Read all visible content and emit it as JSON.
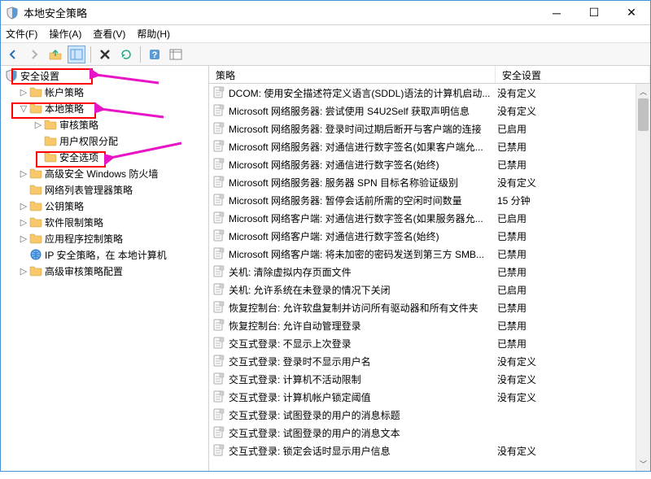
{
  "window": {
    "title": "本地安全策略"
  },
  "menu": {
    "file": "文件(F)",
    "action": "操作(A)",
    "view": "查看(V)",
    "help": "帮助(H)"
  },
  "tree": {
    "root": "安全设置",
    "items": [
      {
        "label": "帐户策略",
        "indent": 1,
        "exp": "▷",
        "type": "folder"
      },
      {
        "label": "本地策略",
        "indent": 1,
        "exp": "▽",
        "type": "folder"
      },
      {
        "label": "审核策略",
        "indent": 2,
        "exp": "▷",
        "type": "folder"
      },
      {
        "label": "用户权限分配",
        "indent": 2,
        "exp": "",
        "type": "folder"
      },
      {
        "label": "安全选项",
        "indent": 2,
        "exp": "",
        "type": "folder"
      },
      {
        "label": "高级安全 Windows 防火墙",
        "indent": 1,
        "exp": "▷",
        "type": "folder"
      },
      {
        "label": "网络列表管理器策略",
        "indent": 1,
        "exp": "",
        "type": "folder"
      },
      {
        "label": "公钥策略",
        "indent": 1,
        "exp": "▷",
        "type": "folder"
      },
      {
        "label": "软件限制策略",
        "indent": 1,
        "exp": "▷",
        "type": "folder"
      },
      {
        "label": "应用程序控制策略",
        "indent": 1,
        "exp": "▷",
        "type": "folder"
      },
      {
        "label": "IP 安全策略，在 本地计算机",
        "indent": 1,
        "exp": "",
        "type": "ip"
      },
      {
        "label": "高级审核策略配置",
        "indent": 1,
        "exp": "▷",
        "type": "folder"
      }
    ]
  },
  "list": {
    "col1": "策略",
    "col2": "安全设置",
    "rows": [
      {
        "name": "DCOM: 使用安全描述符定义语言(SDDL)语法的计算机启动...",
        "val": "没有定义"
      },
      {
        "name": "Microsoft 网络服务器: 尝试使用 S4U2Self 获取声明信息",
        "val": "没有定义"
      },
      {
        "name": "Microsoft 网络服务器: 登录时间过期后断开与客户端的连接",
        "val": "已启用"
      },
      {
        "name": "Microsoft 网络服务器: 对通信进行数字签名(如果客户端允...",
        "val": "已禁用"
      },
      {
        "name": "Microsoft 网络服务器: 对通信进行数字签名(始终)",
        "val": "已禁用"
      },
      {
        "name": "Microsoft 网络服务器: 服务器 SPN 目标名称验证级别",
        "val": "没有定义"
      },
      {
        "name": "Microsoft 网络服务器: 暂停会话前所需的空闲时间数量",
        "val": "15 分钟"
      },
      {
        "name": "Microsoft 网络客户端: 对通信进行数字签名(如果服务器允...",
        "val": "已启用"
      },
      {
        "name": "Microsoft 网络客户端: 对通信进行数字签名(始终)",
        "val": "已禁用"
      },
      {
        "name": "Microsoft 网络客户端: 将未加密的密码发送到第三方 SMB...",
        "val": "已禁用"
      },
      {
        "name": "关机: 清除虚拟内存页面文件",
        "val": "已禁用"
      },
      {
        "name": "关机: 允许系统在未登录的情况下关闭",
        "val": "已启用"
      },
      {
        "name": "恢复控制台: 允许软盘复制并访问所有驱动器和所有文件夹",
        "val": "已禁用"
      },
      {
        "name": "恢复控制台: 允许自动管理登录",
        "val": "已禁用"
      },
      {
        "name": "交互式登录: 不显示上次登录",
        "val": "已禁用"
      },
      {
        "name": "交互式登录: 登录时不显示用户名",
        "val": "没有定义"
      },
      {
        "name": "交互式登录: 计算机不活动限制",
        "val": "没有定义"
      },
      {
        "name": "交互式登录: 计算机帐户锁定阈值",
        "val": "没有定义"
      },
      {
        "name": "交互式登录: 试图登录的用户的消息标题",
        "val": ""
      },
      {
        "name": "交互式登录: 试图登录的用户的消息文本",
        "val": ""
      },
      {
        "name": "交互式登录: 锁定会话时显示用户信息",
        "val": "没有定义"
      }
    ]
  }
}
